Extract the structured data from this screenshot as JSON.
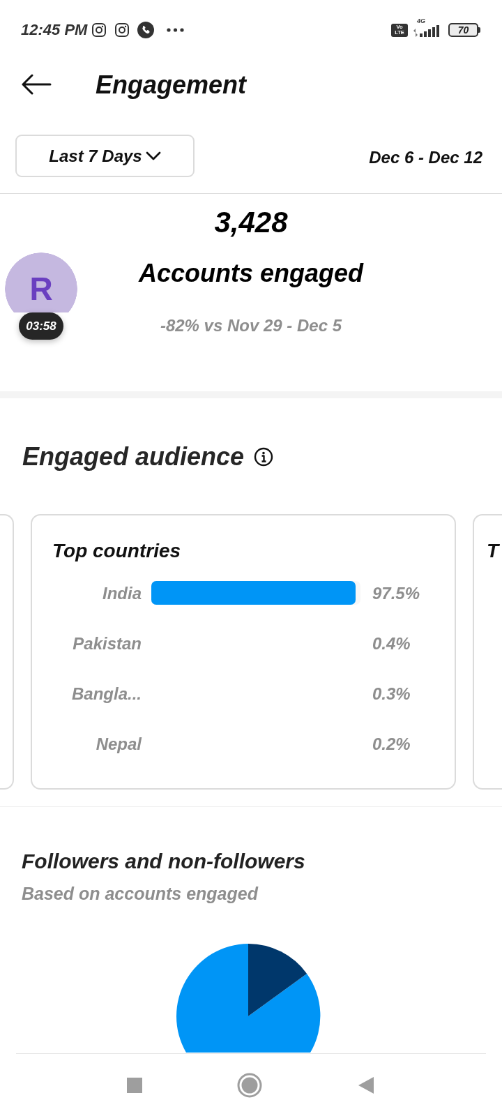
{
  "status_bar": {
    "time": "12:45 PM",
    "volte": [
      "Vo",
      "LTE"
    ],
    "network": "4G",
    "battery": "70"
  },
  "header": {
    "title": "Engagement"
  },
  "period": {
    "dropdown": "Last 7 Days",
    "date_range": "Dec 6 - Dec 12"
  },
  "summary": {
    "value": "3,428",
    "label": "Accounts engaged",
    "comparison": "-82% vs Nov 29 - Dec 5"
  },
  "chat_bubble": {
    "initial": "R",
    "timer": "03:58"
  },
  "engaged_audience": {
    "title": "Engaged audience",
    "cards": [
      {
        "kind": "edge"
      },
      {
        "kind": "full",
        "title": "Top countries",
        "rows": [
          {
            "country": "India",
            "share": "97.5%",
            "level": 0.975
          },
          {
            "country": "Pakistan",
            "share": "0.4%"
          },
          {
            "country": "Bangla...",
            "share": "0.3%"
          },
          {
            "country": "Nepal",
            "share": "0.2%"
          }
        ]
      },
      {
        "kind": "peek",
        "title": "T"
      }
    ]
  },
  "followers": {
    "title": "Followers and non-followers",
    "subtitle": "Based on accounts engaged"
  }
}
